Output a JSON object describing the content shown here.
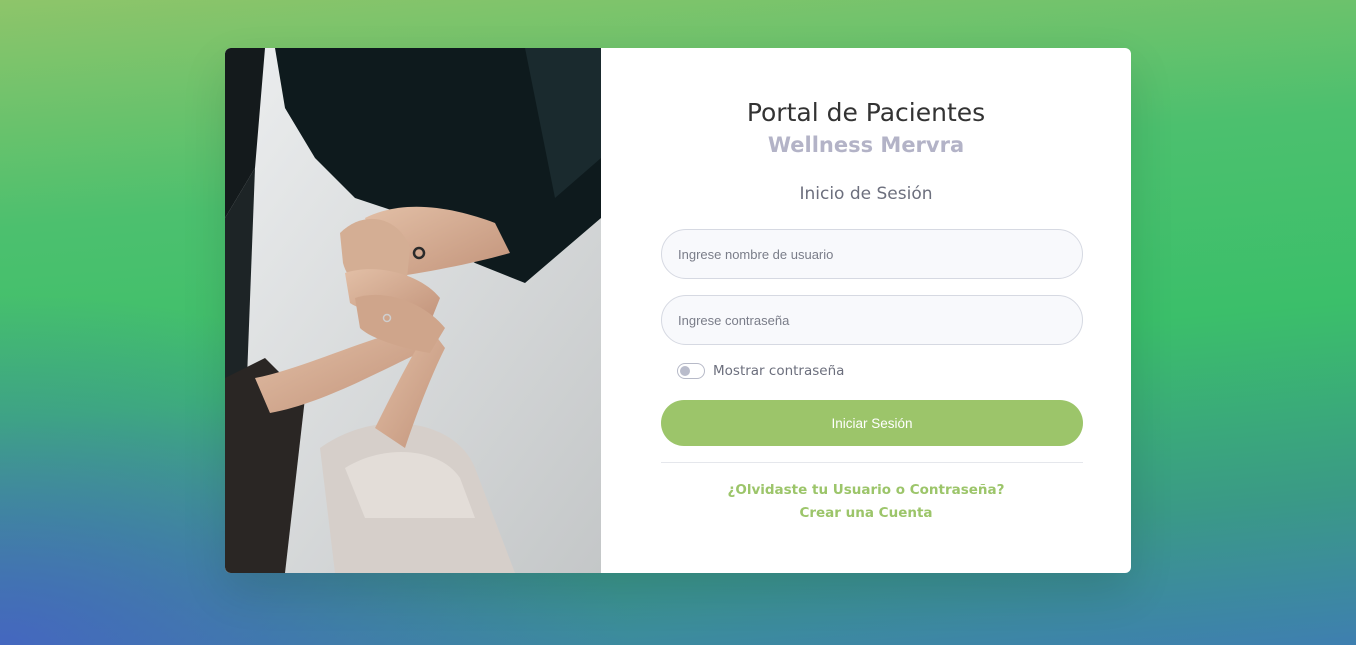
{
  "portal": {
    "title": "Portal de Pacientes",
    "subtitle": "Wellness Mervra",
    "section_title": "Inicio de Sesión"
  },
  "form": {
    "username_placeholder": "Ingrese nombre de usuario",
    "username_value": "",
    "password_placeholder": "Ingrese contraseña",
    "password_value": "",
    "show_password_label": "Mostrar contraseña",
    "show_password_checked": false,
    "submit_label": "Iniciar Sesión"
  },
  "links": {
    "forgot": "¿Olvidaste tu Usuario o Contraseña?",
    "create_account": "Crear una Cuenta"
  },
  "colors": {
    "accent": "#9cc56a",
    "title": "#333333",
    "subtitle": "#b3b3c7"
  },
  "image": {
    "semantic": "photo-holding-hands"
  }
}
